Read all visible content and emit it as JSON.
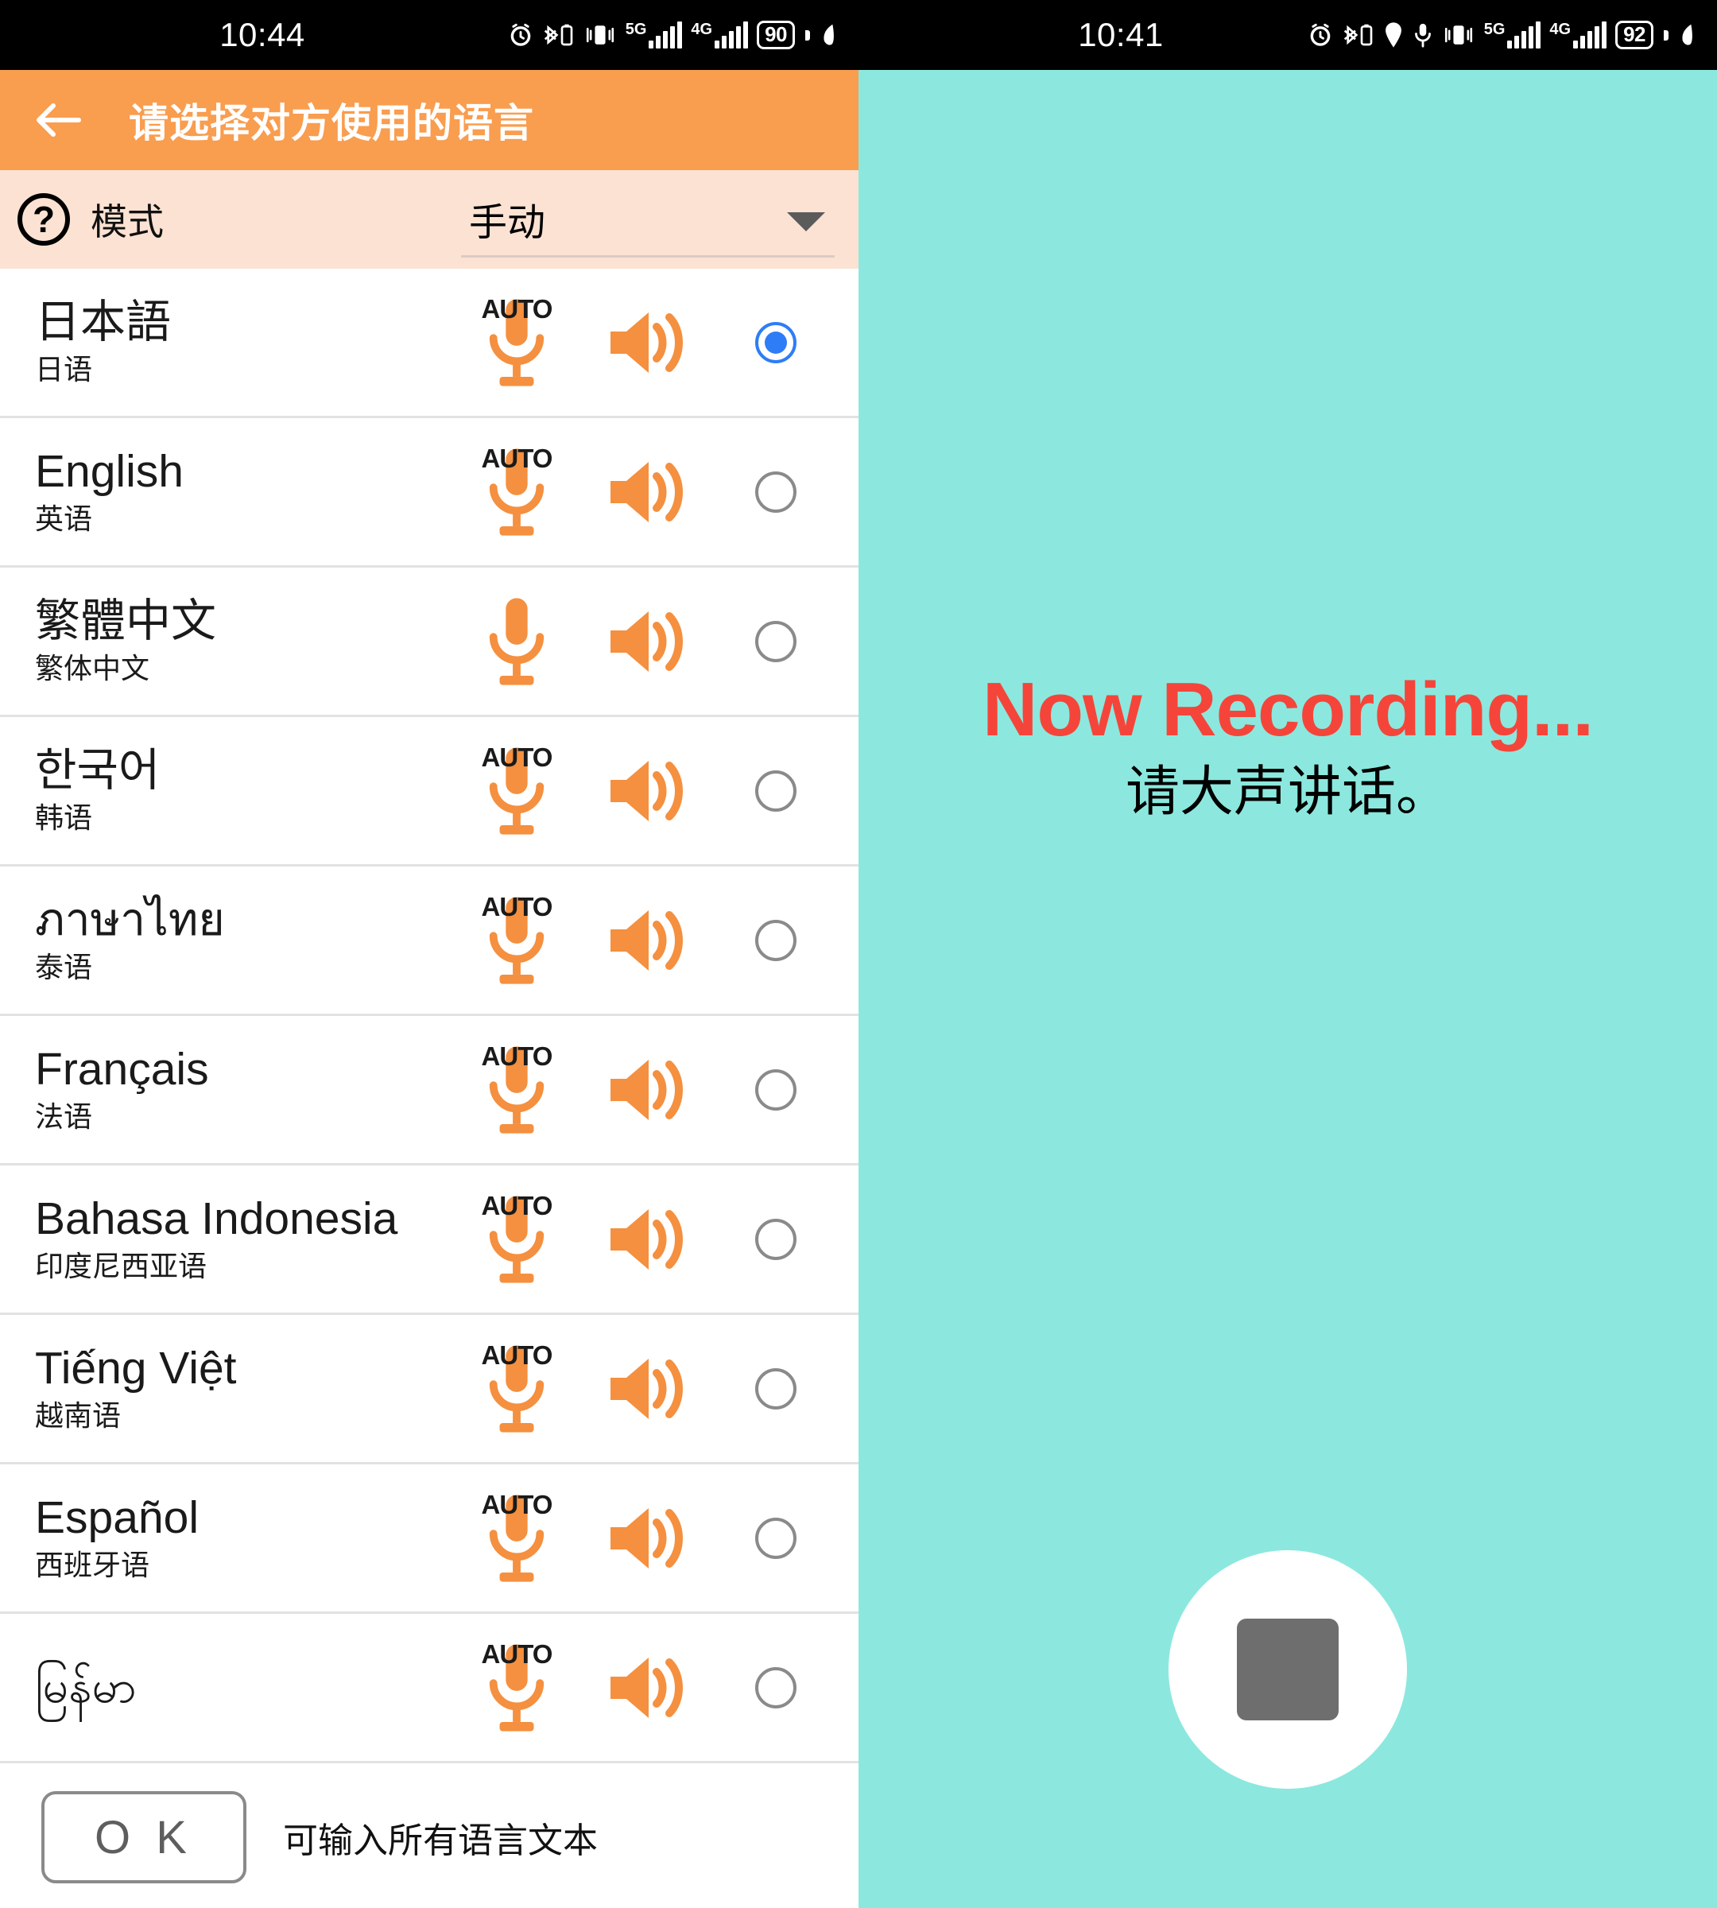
{
  "left_status_bar": {
    "time": "10:44",
    "battery": "90",
    "network_5g": "5G",
    "network_4g": "4G",
    "icons": [
      "alarm-icon",
      "bluetooth-battery-icon",
      "vibrate-icon",
      "signal-5g-icon",
      "signal-4g-icon",
      "battery-icon",
      "eco-icon"
    ]
  },
  "right_status_bar": {
    "time": "10:41",
    "battery": "92",
    "network_5g": "5G",
    "network_4g": "4G",
    "icons": [
      "alarm-icon",
      "bluetooth-battery-icon",
      "location-icon",
      "microphone-icon",
      "vibrate-icon",
      "signal-5g-icon",
      "signal-4g-icon",
      "battery-icon",
      "eco-icon"
    ]
  },
  "app_bar": {
    "back_label": "←",
    "title": "请选择对方使用的语言",
    "background": "#f99d4f"
  },
  "mode_bar": {
    "help_glyph": "?",
    "label": "模式",
    "selected_value": "手动",
    "background": "#fce2d2"
  },
  "languages": [
    {
      "native": "日本語",
      "chinese": "日语",
      "auto": "AUTO",
      "has_auto": true,
      "selected": true
    },
    {
      "native": "English",
      "chinese": "英语",
      "auto": "AUTO",
      "has_auto": true,
      "selected": false
    },
    {
      "native": "繁體中文",
      "chinese": "繁体中文",
      "auto": "",
      "has_auto": false,
      "selected": false
    },
    {
      "native": "한국어",
      "chinese": "韩语",
      "auto": "AUTO",
      "has_auto": true,
      "selected": false
    },
    {
      "native": "ภาษาไทย",
      "chinese": "泰语",
      "auto": "AUTO",
      "has_auto": true,
      "selected": false
    },
    {
      "native": "Français",
      "chinese": "法语",
      "auto": "AUTO",
      "has_auto": true,
      "selected": false
    },
    {
      "native": "Bahasa Indonesia",
      "chinese": "印度尼西亚语",
      "auto": "AUTO",
      "has_auto": true,
      "selected": false
    },
    {
      "native": "Tiếng Việt",
      "chinese": "越南语",
      "auto": "AUTO",
      "has_auto": true,
      "selected": false
    },
    {
      "native": "Español",
      "chinese": "西班牙语",
      "auto": "AUTO",
      "has_auto": true,
      "selected": false
    },
    {
      "native": "မြန်မာ",
      "chinese": "",
      "auto": "AUTO",
      "has_auto": true,
      "selected": false
    }
  ],
  "bottom_bar": {
    "ok_label": "O K",
    "note": "可输入所有语言文本"
  },
  "recording_panel": {
    "title": "Now Recording...",
    "subtitle": "请大声讲话。",
    "title_color": "#f5453a",
    "background": "#8ce8de",
    "stop_button_name": "stop-recording-button"
  }
}
